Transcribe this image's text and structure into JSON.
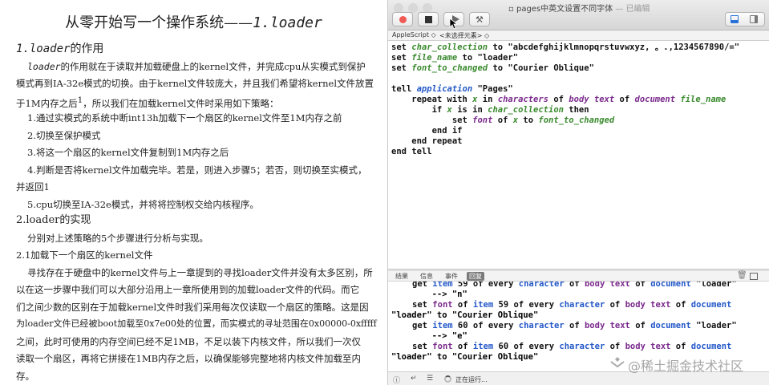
{
  "document": {
    "title": "从零开始写一个操作系统——",
    "title_mono": "1.loader",
    "section1": {
      "mono": "1.loader",
      "text": "的作用"
    },
    "p1": [
      {
        "mono": "loader",
        "text": "的作用就在于读取并加载硬盘上的kernel文件，并完成cpu从实模式到保护"
      },
      {
        "text": "模式再到IA-32e模式的切换。由于kernel文件较庞大，并且我们希望将kernel文件放置"
      },
      {
        "text": "于1M内存之后",
        "sup": "1",
        "rest": "，所以我们在加载kernel文件时采用如下策略："
      }
    ],
    "steps": [
      "1.通过实模式的系统中断int13h加载下一个扇区的kernel文件至1M内存之前",
      "2.切换至保护模式",
      "3.将这一个扇区的kernel文件复制到1M内存之后",
      "4.判断是否将kernel文件加载完毕。若是，则进入步骤5；若否，则切换至实模式，",
      "并返回1",
      "5.cpu切换至IA-32e模式，并将将控制权交给内核程序。"
    ],
    "section2": "2.loader的实现",
    "p2": "分别对上述策略的5个步骤进行分析与实现。",
    "section21": "2.1加载下一个扇区的kernel文件",
    "p3": [
      "寻找存在于硬盘中的kernel文件与上一章提到的寻找loader文件并没有太多区别，所",
      "以在这一步骤中我们可以大部分沿用上一章所使用到的加载loader文件的代码。而它",
      "们之间少数的区别在于加载kernel文件时我们采用每次仅读取一个扇区的策略。这是因",
      "为loader文件已经被boot加载至0x7e00处的位置，而实模式的寻址范围在0x00000-0xfffff",
      "之间，此时可使用的内存空间已经不足1MB，不足以装下内核文件，所以我们一次仅",
      "读取一个扇区，再将它拼接在1MB内存之后，以确保能够完整地将内核文件加载至内",
      "存。"
    ]
  },
  "window": {
    "title": "pages中英文设置不同字体",
    "title_suffix": " — 已编辑",
    "language": "AppleScript ◇",
    "element": "<未选择元素> ◇",
    "accent": "#2a72d8"
  },
  "script": {
    "l1": {
      "k1": "set ",
      "v": "char_collection",
      "k2": " to ",
      "s": "\"abcdefghijklmnopqrstuvwxyz, 。.,1234567890/=\""
    },
    "l2": {
      "k1": "set ",
      "v": "file_name",
      "k2": " to ",
      "s": "\"loader\""
    },
    "l3": {
      "k1": "set ",
      "v": "font_to_changed",
      "k2": " to ",
      "s": "\"Courier Oblique\""
    },
    "l4": {
      "k1": "tell ",
      "a": "application",
      "s": " \"Pages\""
    },
    "l5": {
      "k1": "    repeat with ",
      "v": "x",
      "k2": " in ",
      "c1": "characters",
      "k3": " of ",
      "c2": "body text",
      "k4": " of ",
      "c3": "document",
      "k5": " ",
      "v2": "file_name"
    },
    "l6": {
      "k1": "        if ",
      "v": "x",
      "k2": " is in ",
      "v2": "char_collection",
      "k3": " then"
    },
    "l7": {
      "k1": "            set ",
      "c1": "font",
      "k2": " of ",
      "v": "x",
      "k3": " to ",
      "v2": "font_to_changed"
    },
    "l8": "        end if",
    "l9": "    end repeat",
    "l10": "end tell"
  },
  "log": {
    "tabs": [
      "结果",
      "信息",
      "事件",
      "回复"
    ],
    "active_tab": "回复",
    "lines": [
      {
        "k1": "get ",
        "c1": "item",
        "k2": " 59 of every ",
        "c2": "character",
        "k3": " of ",
        "c3": "body text",
        "k4": " of ",
        "c4": "document",
        "s": " \"loader\""
      },
      {
        "plain": "        --> \"n\""
      },
      {
        "k1": "set ",
        "c1": "font",
        "k2": " of ",
        "c2": "item",
        "k3": " 59 of every ",
        "c3": "character",
        "k4": " of ",
        "c4": "body text",
        "k5": " of ",
        "c5": "document"
      },
      {
        "plain": "\"loader\" to \"Courier Oblique\""
      },
      {
        "k1": "get ",
        "c1": "item",
        "k2": " 60 of every ",
        "c2": "character",
        "k3": " of ",
        "c3": "body text",
        "k4": " of ",
        "c4": "document",
        "s": " \"loader\""
      },
      {
        "plain": "        --> \"e\""
      },
      {
        "k1": "set ",
        "c1": "font",
        "k2": " of ",
        "c2": "item",
        "k3": " 60 of every ",
        "c3": "character",
        "k4": " of ",
        "c4": "body text",
        "k5": " of ",
        "c5": "document"
      },
      {
        "plain": "\"loader\" to \"Courier Oblique\""
      }
    ]
  },
  "status": {
    "running": "正在运行..."
  },
  "watermark": "@稀土掘金技术社区"
}
